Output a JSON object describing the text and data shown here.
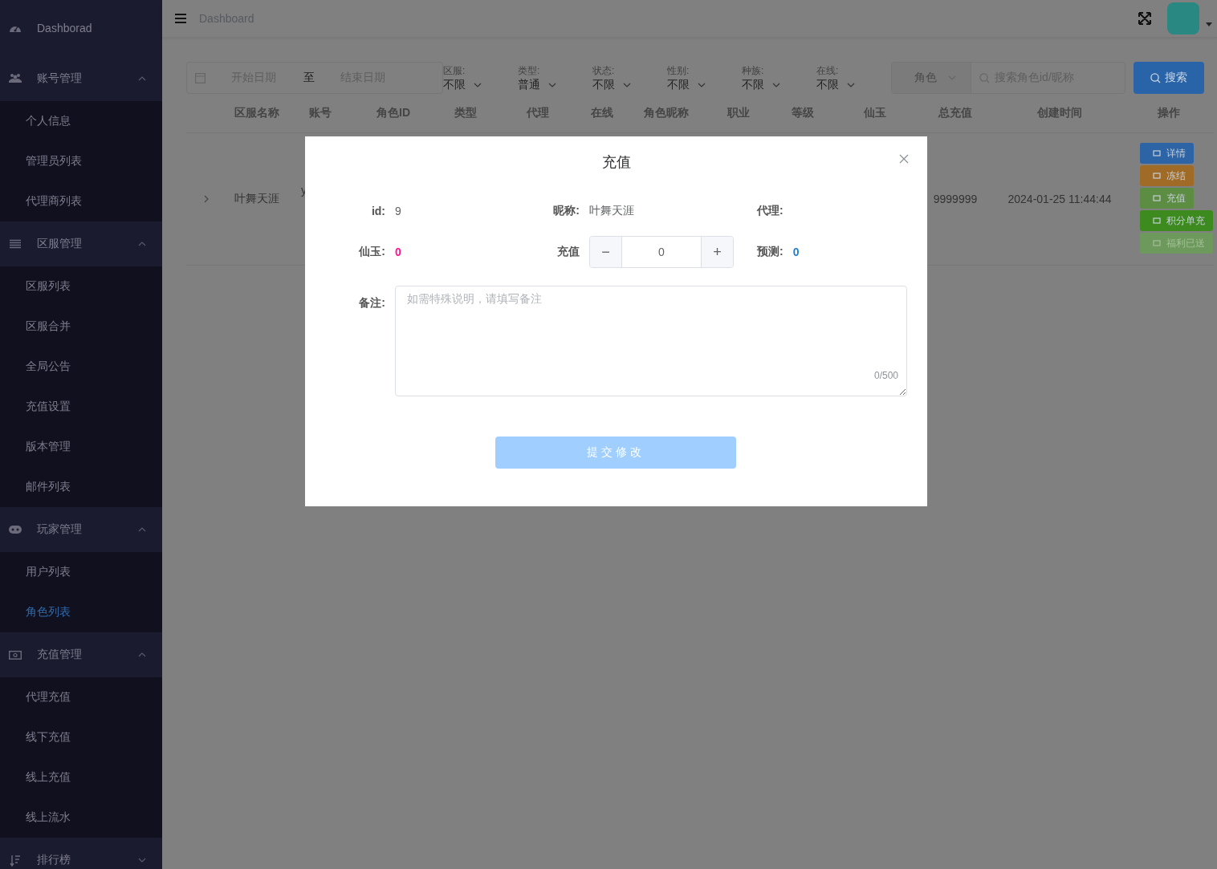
{
  "sidebar": {
    "items": [
      {
        "label": "Dashborad"
      },
      {
        "label": "账号管理",
        "expanded": true,
        "children": [
          {
            "label": "个人信息",
            "selected": false
          },
          {
            "label": "管理员列表",
            "selected": false
          },
          {
            "label": "代理商列表",
            "selected": false
          }
        ]
      },
      {
        "label": "区服管理",
        "expanded": true,
        "children": [
          {
            "label": "区服列表",
            "selected": false
          },
          {
            "label": "区服合并",
            "selected": false
          },
          {
            "label": "全局公告",
            "selected": false
          },
          {
            "label": "充值设置",
            "selected": false
          },
          {
            "label": "版本管理",
            "selected": false
          },
          {
            "label": "邮件列表",
            "selected": false
          }
        ]
      },
      {
        "label": "玩家管理",
        "expanded": true,
        "children": [
          {
            "label": "用户列表",
            "selected": false
          },
          {
            "label": "角色列表",
            "selected": true
          }
        ]
      },
      {
        "label": "充值管理",
        "expanded": true,
        "children": [
          {
            "label": "代理充值",
            "selected": false
          },
          {
            "label": "线下充值",
            "selected": false
          },
          {
            "label": "线上充值",
            "selected": false
          },
          {
            "label": "线上流水",
            "selected": false
          }
        ]
      },
      {
        "label": "排行榜",
        "expanded": false
      }
    ]
  },
  "header": {
    "breadcrumb": "Dashboard"
  },
  "filters": {
    "date_range": {
      "start_placeholder": "开始日期",
      "separator": "至",
      "end_placeholder": "结束日期"
    },
    "selects": [
      {
        "label": "区服:",
        "value": "不限"
      },
      {
        "label": "类型:",
        "value": "普通"
      },
      {
        "label": "状态:",
        "value": "不限"
      },
      {
        "label": "性别:",
        "value": "不限"
      },
      {
        "label": "种族:",
        "value": "不限"
      },
      {
        "label": "在线:",
        "value": "不限"
      }
    ],
    "search": {
      "scope": "角色",
      "placeholder": "搜索角色id/昵称"
    },
    "search_button": "搜索"
  },
  "table": {
    "columns": [
      "区服名称",
      "账号",
      "角色ID",
      "类型",
      "代理",
      "在线",
      "角色昵称",
      "职业",
      "等级",
      "仙玉",
      "总充值",
      "创建时间",
      "操作"
    ],
    "rows": [
      {
        "expanded": false,
        "cells": [
          "叶舞天涯",
          "y",
          null,
          null,
          null,
          null,
          null,
          null,
          null,
          null,
          "9999999",
          "2024-01-25 11:44:44"
        ],
        "actions": [
          {
            "label": "详情",
            "color": "#2d64a6",
            "disabled": false
          },
          {
            "label": "冻结",
            "color": "#a06b26",
            "disabled": false
          },
          {
            "label": "充值",
            "color": "#5c8d43",
            "disabled": false
          },
          {
            "label": "积分单充",
            "color": "#3d8a1f",
            "disabled": false
          },
          {
            "label": "福利已送",
            "color": "#6d9a5c",
            "disabled": true
          }
        ]
      }
    ]
  },
  "dialog": {
    "title": "充值",
    "info": [
      {
        "label": "id:",
        "value": "9"
      },
      {
        "label": "昵称:",
        "value": "叶舞天涯"
      },
      {
        "label": "代理:"
      }
    ],
    "balance": {
      "label": "仙玉:",
      "value": "0"
    },
    "amount": {
      "label": "充值",
      "value": "0",
      "minus": "−",
      "plus": "+"
    },
    "forecast": {
      "label": "预测:",
      "value": "0"
    },
    "remark": {
      "label": "备注:",
      "placeholder": "如需特殊说明，请填写备注",
      "counter": "0/500"
    },
    "submit": {
      "label": "提交修改",
      "disabled": true
    }
  }
}
